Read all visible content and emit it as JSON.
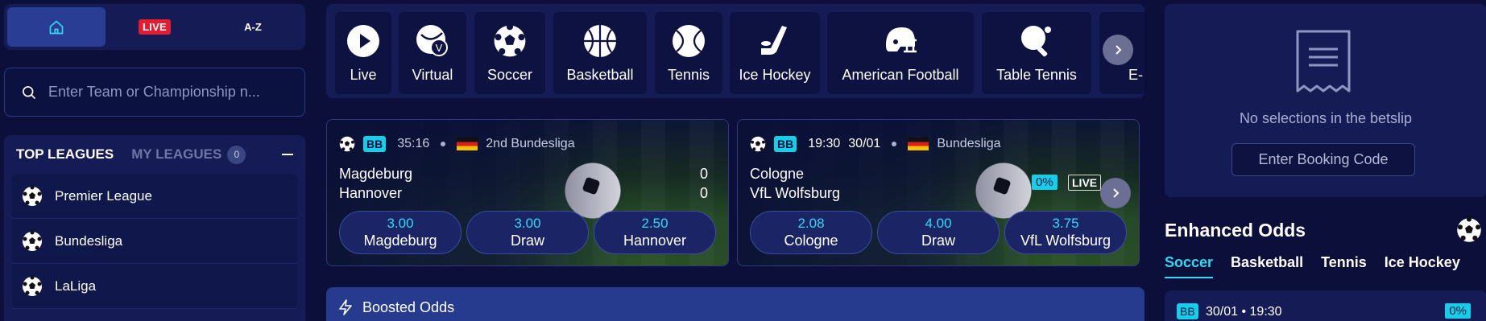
{
  "nav": {
    "live_label": "LIVE",
    "az_label": "A-Z"
  },
  "search": {
    "placeholder": "Enter Team or Championship n..."
  },
  "leagues": {
    "top_label": "TOP LEAGUES",
    "my_label": "MY LEAGUES",
    "my_count": "0",
    "items": [
      {
        "label": "Premier League"
      },
      {
        "label": "Bundesliga"
      },
      {
        "label": "LaLiga"
      }
    ]
  },
  "sports": [
    {
      "label": "Live",
      "icon": "play-icon"
    },
    {
      "label": "Virtual",
      "icon": "virtual-icon"
    },
    {
      "label": "Soccer",
      "icon": "soccer-ball-icon"
    },
    {
      "label": "Basketball",
      "icon": "basketball-icon"
    },
    {
      "label": "Tennis",
      "icon": "tennis-ball-icon"
    },
    {
      "label": "Ice Hockey",
      "icon": "hockey-stick-icon"
    },
    {
      "label": "American Football",
      "icon": "football-helmet-icon"
    },
    {
      "label": "Table Tennis",
      "icon": "table-tennis-icon"
    },
    {
      "label": "E-",
      "icon": "esports-icon"
    }
  ],
  "matches": [
    {
      "badge": "BB",
      "time": "35:16",
      "league": "2nd Bundesliga",
      "home": "Magdeburg",
      "away": "Hannover",
      "home_score": "0",
      "away_score": "0",
      "odds": [
        {
          "value": "3.00",
          "label": "Magdeburg"
        },
        {
          "value": "3.00",
          "label": "Draw"
        },
        {
          "value": "2.50",
          "label": "Hannover"
        }
      ]
    },
    {
      "badge": "BB",
      "time": "19:30",
      "date": "30/01",
      "league": "Bundesliga",
      "home": "Cologne",
      "away": "VfL Wolfsburg",
      "boost": "0%",
      "live": "LIVE",
      "odds": [
        {
          "value": "2.08",
          "label": "Cologne"
        },
        {
          "value": "4.00",
          "label": "Draw"
        },
        {
          "value": "3.75",
          "label": "VfL Wolfsburg"
        }
      ]
    }
  ],
  "boosted": {
    "label": "Boosted Odds"
  },
  "betslip": {
    "empty_text": "No selections in the betslip",
    "booking_label": "Enter Booking Code"
  },
  "enhanced": {
    "title": "Enhanced Odds",
    "tabs": [
      "Soccer",
      "Basketball",
      "Tennis",
      "Ice Hockey"
    ],
    "card": {
      "badge": "BB",
      "datetime": "30/01 • 19:30",
      "boost": "0%"
    }
  },
  "colors": {
    "accent": "#31d9f2",
    "live": "#e11d2f",
    "panel": "#151c55",
    "background": "#0b0f3a"
  }
}
